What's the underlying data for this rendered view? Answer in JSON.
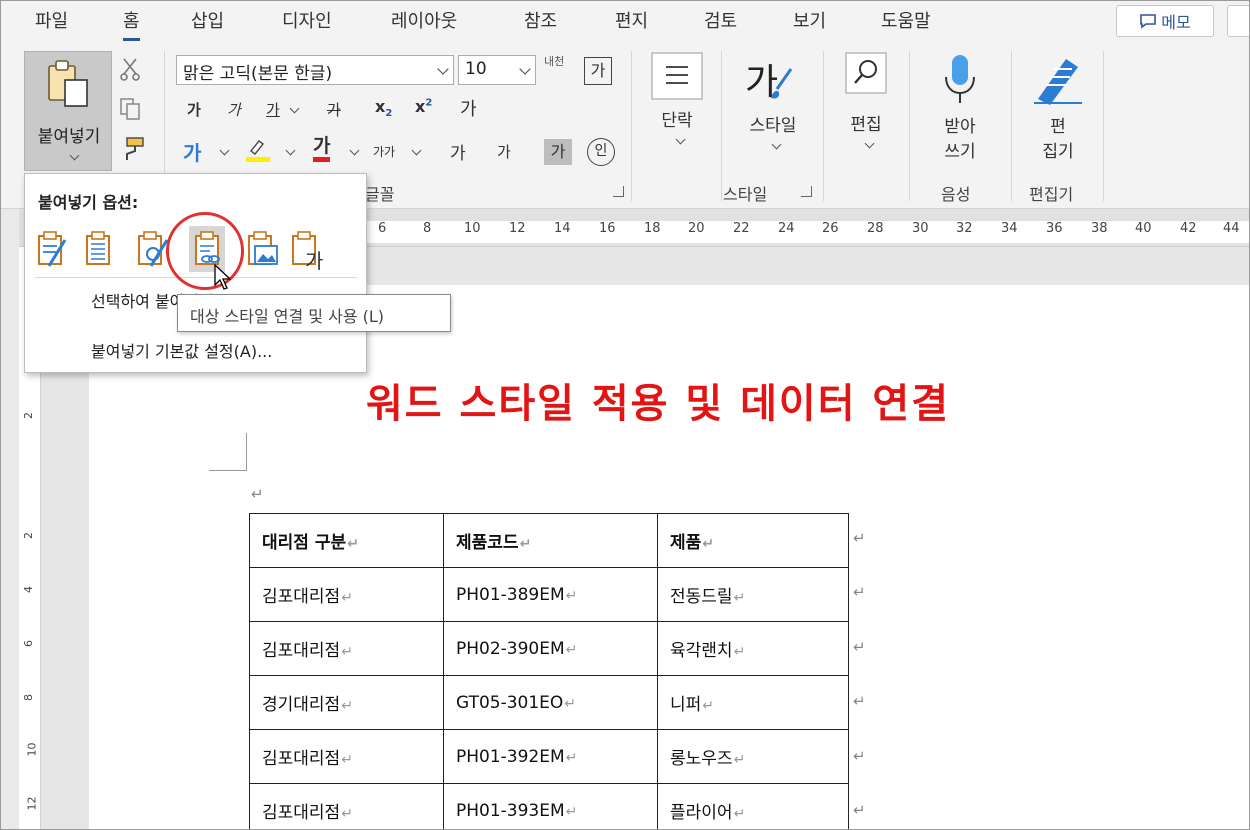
{
  "menu": {
    "tabs": [
      "파일",
      "홈",
      "삽입",
      "디자인",
      "레이아웃",
      "참조",
      "편지",
      "검토",
      "보기",
      "도움말"
    ],
    "active_tab": "홈",
    "memo_label": "메모"
  },
  "ribbon": {
    "paste_label": "붙여넣기",
    "font_name": "맑은 고딕(본문 한글)",
    "font_size": "10",
    "font_group_label": "글꼴",
    "bold": "가",
    "italic": "가",
    "underline": "가",
    "strike": "가",
    "subscript": "x",
    "superscript": "x",
    "clear_format": "가",
    "font_color": "가",
    "text_effect": "가",
    "char_spacing": "가가",
    "grow_font": "가",
    "shrink_font": "가",
    "char_shading": "가",
    "enclose": "인",
    "phonetic": "내천",
    "char_border": "가",
    "paragraph_label": "단락",
    "styles_label": "스타일",
    "styles_group_label": "스타일",
    "editing_label": "편집",
    "dictate_label_1": "받아",
    "dictate_label_2": "쓰기",
    "voice_group_label": "음성",
    "editor_label_1": "편",
    "editor_label_2": "집기",
    "editor_group_label": "편집기",
    "styles_glyph": "가"
  },
  "ruler": {
    "numbers": [
      "6",
      "8",
      "10",
      "12",
      "14",
      "16",
      "18",
      "20",
      "22",
      "24",
      "26",
      "28",
      "30",
      "32",
      "34",
      "36",
      "38",
      "40",
      "42",
      "44"
    ],
    "vertical_numbers": [
      "2",
      "2",
      "4",
      "6",
      "8",
      "10",
      "12"
    ]
  },
  "paste_menu": {
    "title": "붙여넣기 옵션:",
    "item_select": "선택하여 붙여넣기",
    "item_default": "붙여넣기 기본값 설정(A)...",
    "tooltip": "대상 스타일 연결 및 사용 (L)"
  },
  "document": {
    "title": "워드 스타일 적용 및 데이터 연결",
    "table": {
      "headers": [
        "대리점 구분",
        "제품코드",
        "제품"
      ],
      "rows": [
        [
          "김포대리점",
          "PH01-389EM",
          "전동드릴"
        ],
        [
          "김포대리점",
          "PH02-390EM",
          "육각랜치"
        ],
        [
          "경기대리점",
          "GT05-301EO",
          "니퍼"
        ],
        [
          "김포대리점",
          "PH01-392EM",
          "롱노우즈"
        ],
        [
          "김포대리점",
          "PH01-393EM",
          "플라이어"
        ]
      ]
    }
  },
  "colors": {
    "accent": "#2b579a",
    "title_red": "#e31414",
    "highlight_circle": "#e23030"
  }
}
